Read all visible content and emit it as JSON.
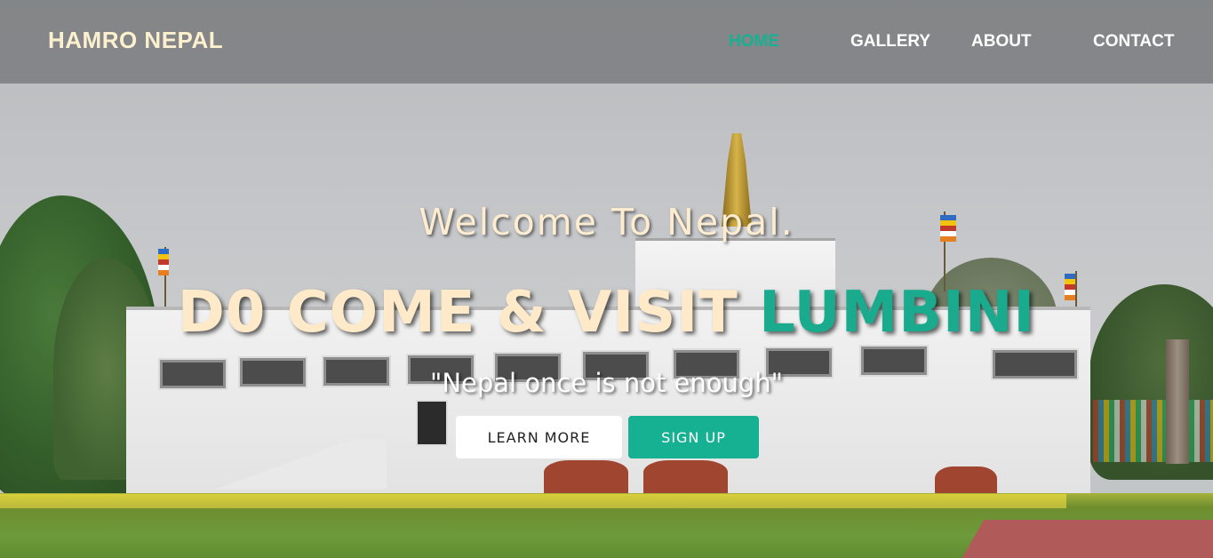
{
  "navbar": {
    "brand": "HAMRO NEPAL",
    "items": [
      {
        "label": "HOME",
        "active": true
      },
      {
        "label": "GALLERY",
        "active": false
      },
      {
        "label": "ABOUT",
        "active": false
      },
      {
        "label": "CONTACT",
        "active": false
      }
    ]
  },
  "hero": {
    "welcome": "Welcome To Nepal.",
    "headline_prefix": "D0 COME & VISIT",
    "headline_accent": "LUMBINI",
    "tagline": "\"Nepal once is not enough\"",
    "learn_more_label": "LEARN MORE",
    "sign_up_label": "SIGN UP"
  },
  "colors": {
    "accent": "#16b093",
    "brand_text": "#fdf0cf",
    "nav_background": "#7a7c7e"
  },
  "background": {
    "subject": "Maya Devi Temple, Lumbini photo"
  }
}
